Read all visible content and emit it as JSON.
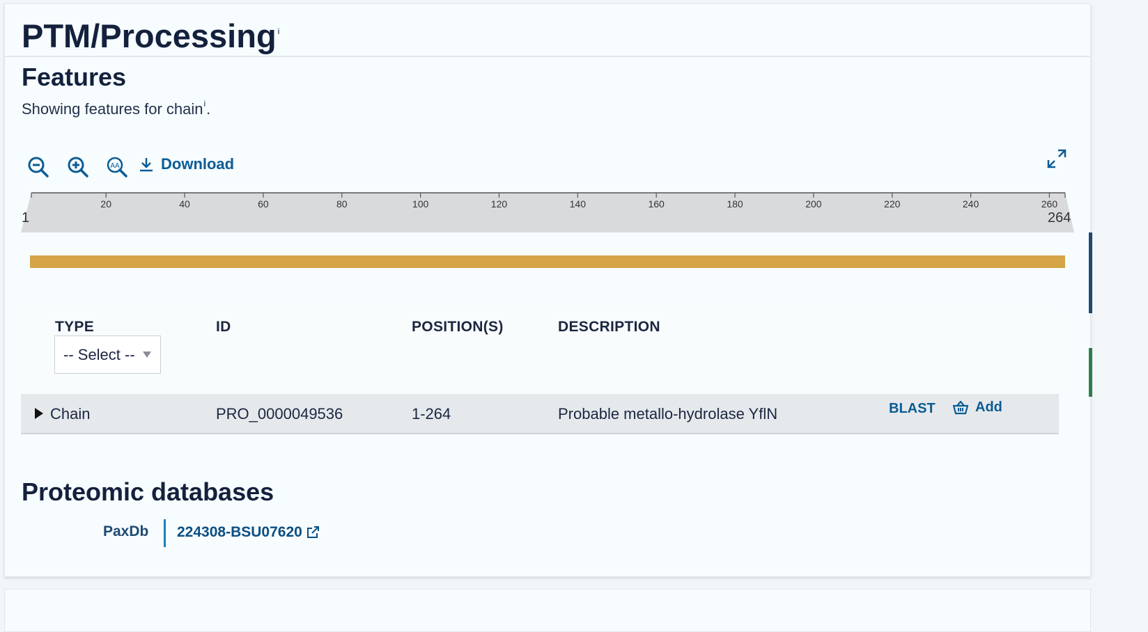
{
  "section": {
    "title": "PTM/Processing",
    "info_mark": "i"
  },
  "features": {
    "title": "Features",
    "subtitle_prefix": "Showing features for chain",
    "subtitle_info": "i",
    "subtitle_suffix": "."
  },
  "toolbar": {
    "zoom_out_icon": "zoom-out-icon",
    "zoom_in_icon": "zoom-in-icon",
    "zoom_text_icon": "zoom-text-icon",
    "download_label": "Download",
    "fullscreen_icon": "fullscreen-icon"
  },
  "ruler": {
    "start": "1",
    "end": "264",
    "ticks": [
      "20",
      "40",
      "60",
      "80",
      "100",
      "120",
      "140",
      "160",
      "180",
      "200",
      "220",
      "240",
      "260"
    ]
  },
  "track": {
    "color": "#d4a446",
    "start": 1,
    "end": 264
  },
  "table": {
    "headers": {
      "type": "TYPE",
      "id": "ID",
      "positions": "POSITION(S)",
      "description": "DESCRIPTION"
    },
    "type_filter": {
      "selected": "-- Select --"
    },
    "rows": [
      {
        "type": "Chain",
        "id": "PRO_0000049536",
        "positions": "1-264",
        "description": "Probable metallo-hydrolase YflN",
        "blast_label": "BLAST",
        "add_label": "Add"
      }
    ]
  },
  "proteomic": {
    "title": "Proteomic databases",
    "db_name": "PaxDb",
    "db_link": "224308-BSU07620"
  },
  "colors": {
    "accent": "#0b5c94",
    "title": "#14213d",
    "chain": "#d4a446"
  }
}
